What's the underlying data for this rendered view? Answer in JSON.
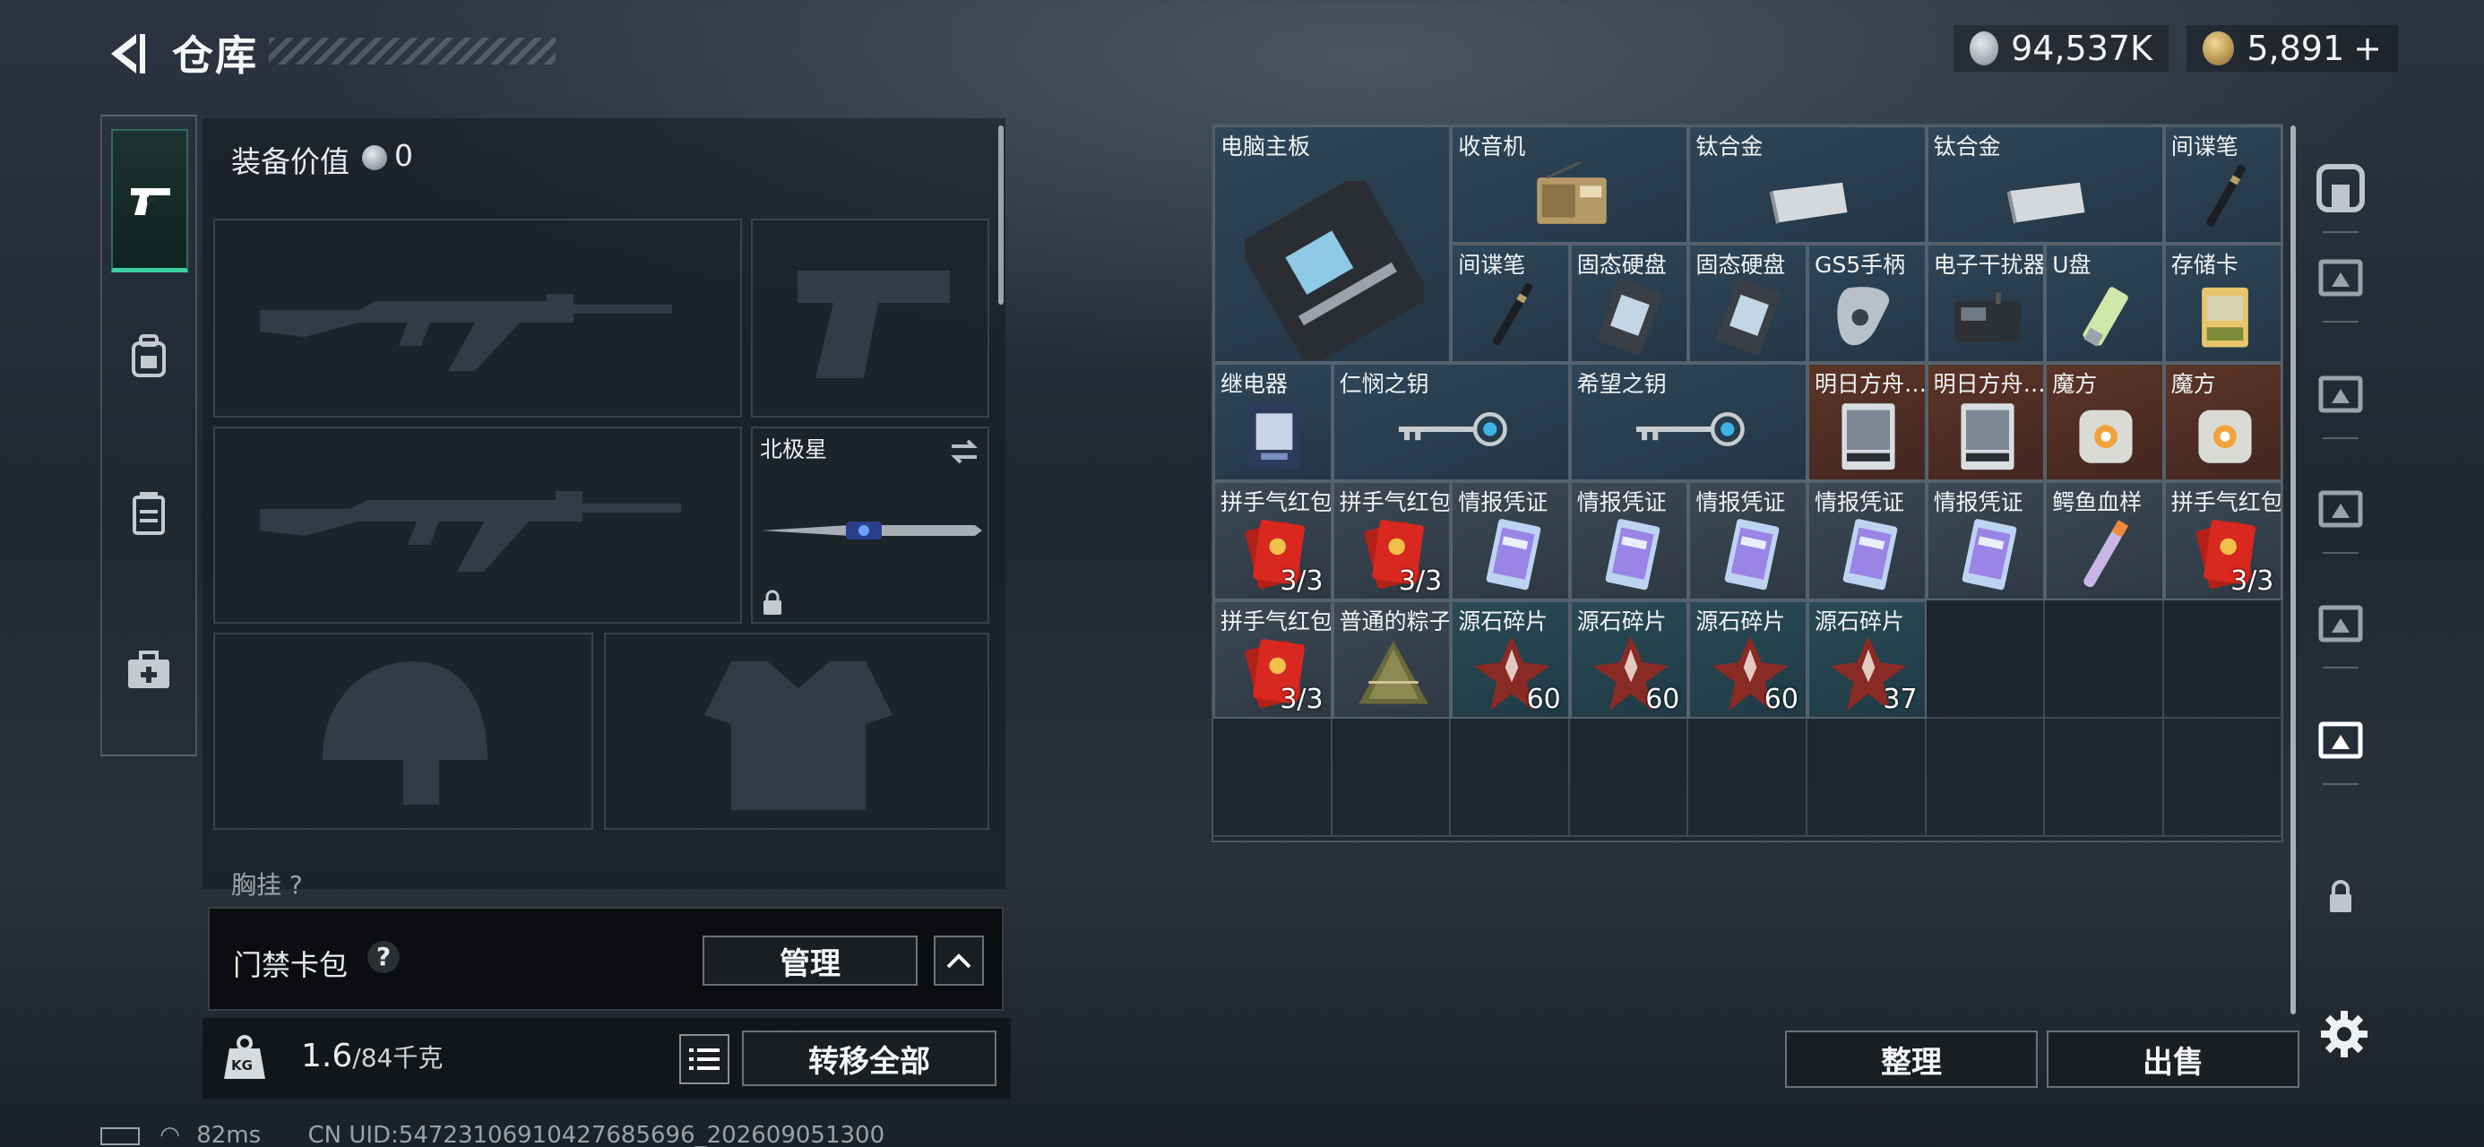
{
  "header": {
    "title": "仓库",
    "currency1": "94,537K",
    "currency2": "5,891",
    "plus": "+",
    "coin1_color": "#b9c0c6",
    "coin2_color": "#c7a35a"
  },
  "left_nav": {
    "items": [
      {
        "icon": "pistol-icon",
        "active": true
      },
      {
        "icon": "backpack-icon"
      },
      {
        "icon": "chest-rig-icon"
      },
      {
        "icon": "medkit-icon"
      }
    ]
  },
  "loadout": {
    "equip_label": "装备价值",
    "equip_value": "0",
    "secondary_label": "北极星",
    "chest_label": "胸挂 ?"
  },
  "access_card": {
    "label": "门禁卡包",
    "help": "?",
    "manage": "管理"
  },
  "weight": {
    "current": "1.6",
    "capacity": "/84千克",
    "icon_label": "KG",
    "transfer_all": "转移全部"
  },
  "inventory": {
    "items": [
      {
        "name": "电脑主板",
        "icon": "motherboard-icon",
        "count": "",
        "bg": "blue"
      },
      {
        "name": "收音机",
        "icon": "radio-icon",
        "count": "",
        "bg": "blue"
      },
      {
        "name": "钛合金",
        "icon": "titanium-ingot-icon",
        "count": "",
        "bg": "blue"
      },
      {
        "name": "钛合金",
        "icon": "titanium-ingot-icon",
        "count": "",
        "bg": "blue"
      },
      {
        "name": "间谍笔",
        "icon": "spy-pen-icon",
        "count": "",
        "bg": "blue"
      },
      {
        "name": "间谍笔",
        "icon": "spy-pen-icon",
        "count": "",
        "bg": "blue"
      },
      {
        "name": "固态硬盘",
        "icon": "ssd-icon",
        "count": "",
        "bg": "blue"
      },
      {
        "name": "固态硬盘",
        "icon": "ssd-icon",
        "count": "",
        "bg": "blue"
      },
      {
        "name": "GS5手柄",
        "icon": "gamepad-icon",
        "count": "",
        "bg": "blue"
      },
      {
        "name": "电子干扰器",
        "icon": "jammer-icon",
        "count": "",
        "bg": "blue"
      },
      {
        "name": "U盘",
        "icon": "usb-drive-icon",
        "count": "",
        "bg": "blue"
      },
      {
        "name": "存储卡",
        "icon": "memory-card-icon",
        "count": "",
        "bg": "blue"
      },
      {
        "name": "继电器",
        "icon": "relay-icon",
        "count": "",
        "bg": "blue"
      },
      {
        "name": "仁悯之钥",
        "icon": "key-icon",
        "count": "",
        "bg": "blue"
      },
      {
        "name": "希望之钥",
        "icon": "key-icon",
        "count": "",
        "bg": "blue"
      },
      {
        "name": "明日方舟…",
        "icon": "arknights-card-icon",
        "count": "",
        "bg": "red"
      },
      {
        "name": "明日方舟…",
        "icon": "arknights-card-icon",
        "count": "",
        "bg": "red"
      },
      {
        "name": "魔方",
        "icon": "cube-icon",
        "count": "",
        "bg": "red"
      },
      {
        "name": "魔方",
        "icon": "cube-icon",
        "count": "",
        "bg": "red"
      },
      {
        "name": "拼手气红包",
        "icon": "red-envelope-icon",
        "count": "3/3",
        "bg": "gray"
      },
      {
        "name": "拼手气红包",
        "icon": "red-envelope-icon",
        "count": "3/3",
        "bg": "gray"
      },
      {
        "name": "情报凭证",
        "icon": "intel-voucher-icon",
        "count": "",
        "bg": "gray"
      },
      {
        "name": "情报凭证",
        "icon": "intel-voucher-icon",
        "count": "",
        "bg": "gray"
      },
      {
        "name": "情报凭证",
        "icon": "intel-voucher-icon",
        "count": "",
        "bg": "gray"
      },
      {
        "name": "情报凭证",
        "icon": "intel-voucher-icon",
        "count": "",
        "bg": "gray"
      },
      {
        "name": "情报凭证",
        "icon": "intel-voucher-icon",
        "count": "",
        "bg": "gray"
      },
      {
        "name": "鳄鱼血样",
        "icon": "blood-vial-icon",
        "count": "",
        "bg": "gray"
      },
      {
        "name": "拼手气红包",
        "icon": "red-envelope-icon",
        "count": "3/3",
        "bg": "gray"
      },
      {
        "name": "拼手气红包",
        "icon": "red-envelope-icon",
        "count": "3/3",
        "bg": "gray"
      },
      {
        "name": "普通的粽子",
        "icon": "zongzi-icon",
        "count": "",
        "bg": "gray"
      },
      {
        "name": "源石碎片",
        "icon": "originium-shard-icon",
        "count": "60",
        "bg": "teal"
      },
      {
        "name": "源石碎片",
        "icon": "originium-shard-icon",
        "count": "60",
        "bg": "teal"
      },
      {
        "name": "源石碎片",
        "icon": "originium-shard-icon",
        "count": "60",
        "bg": "teal"
      },
      {
        "name": "源石碎片",
        "icon": "originium-shard-icon",
        "count": "37",
        "bg": "teal"
      }
    ]
  },
  "actions": {
    "sort": "整理",
    "sell": "出售"
  },
  "right_nav": {
    "items": [
      "safebox-icon",
      "storage-iii-icon",
      "storage-v-icon",
      "storage-ii-add-icon",
      "storage-iii-b-icon",
      "storage-iii-active-icon",
      "lock-icon"
    ]
  },
  "footer": {
    "ping": "82ms",
    "uid": "CN UID:54723106910427685696_202609051300"
  }
}
